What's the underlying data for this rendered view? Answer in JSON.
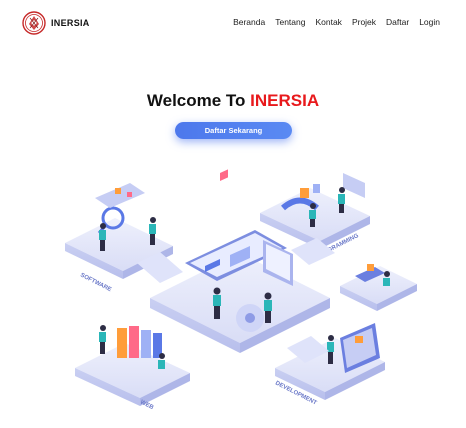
{
  "brand": {
    "name": "INERSIA",
    "logo_icon": "university-crest-icon"
  },
  "nav": {
    "items": [
      {
        "label": "Beranda"
      },
      {
        "label": "Tentang"
      },
      {
        "label": "Kontak"
      },
      {
        "label": "Projek"
      },
      {
        "label": "Daftar"
      },
      {
        "label": "Login"
      }
    ]
  },
  "hero": {
    "title_prefix": "Welcome To ",
    "title_accent": "INERSIA",
    "cta_label": "Daftar Sekarang"
  },
  "illustration": {
    "labels": {
      "software": "SOFTWARE",
      "programming": "PROGRAMMING",
      "web": "WEB",
      "development": "DEVELOPMENT"
    }
  },
  "colors": {
    "accent": "#e8191c",
    "button": "#5580ef",
    "platform": "#e6e9fb",
    "figure_teal": "#2bb6b8"
  }
}
